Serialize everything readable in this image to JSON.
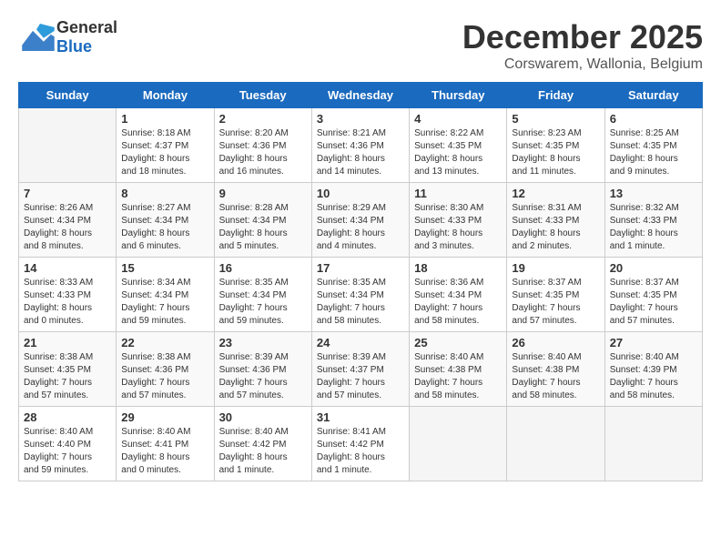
{
  "header": {
    "logo_general": "General",
    "logo_blue": "Blue",
    "month_title": "December 2025",
    "subtitle": "Corswarem, Wallonia, Belgium"
  },
  "weekdays": [
    "Sunday",
    "Monday",
    "Tuesday",
    "Wednesday",
    "Thursday",
    "Friday",
    "Saturday"
  ],
  "weeks": [
    [
      {
        "day": "",
        "info": ""
      },
      {
        "day": "1",
        "info": "Sunrise: 8:18 AM\nSunset: 4:37 PM\nDaylight: 8 hours\nand 18 minutes."
      },
      {
        "day": "2",
        "info": "Sunrise: 8:20 AM\nSunset: 4:36 PM\nDaylight: 8 hours\nand 16 minutes."
      },
      {
        "day": "3",
        "info": "Sunrise: 8:21 AM\nSunset: 4:36 PM\nDaylight: 8 hours\nand 14 minutes."
      },
      {
        "day": "4",
        "info": "Sunrise: 8:22 AM\nSunset: 4:35 PM\nDaylight: 8 hours\nand 13 minutes."
      },
      {
        "day": "5",
        "info": "Sunrise: 8:23 AM\nSunset: 4:35 PM\nDaylight: 8 hours\nand 11 minutes."
      },
      {
        "day": "6",
        "info": "Sunrise: 8:25 AM\nSunset: 4:35 PM\nDaylight: 8 hours\nand 9 minutes."
      }
    ],
    [
      {
        "day": "7",
        "info": "Sunrise: 8:26 AM\nSunset: 4:34 PM\nDaylight: 8 hours\nand 8 minutes."
      },
      {
        "day": "8",
        "info": "Sunrise: 8:27 AM\nSunset: 4:34 PM\nDaylight: 8 hours\nand 6 minutes."
      },
      {
        "day": "9",
        "info": "Sunrise: 8:28 AM\nSunset: 4:34 PM\nDaylight: 8 hours\nand 5 minutes."
      },
      {
        "day": "10",
        "info": "Sunrise: 8:29 AM\nSunset: 4:34 PM\nDaylight: 8 hours\nand 4 minutes."
      },
      {
        "day": "11",
        "info": "Sunrise: 8:30 AM\nSunset: 4:33 PM\nDaylight: 8 hours\nand 3 minutes."
      },
      {
        "day": "12",
        "info": "Sunrise: 8:31 AM\nSunset: 4:33 PM\nDaylight: 8 hours\nand 2 minutes."
      },
      {
        "day": "13",
        "info": "Sunrise: 8:32 AM\nSunset: 4:33 PM\nDaylight: 8 hours\nand 1 minute."
      }
    ],
    [
      {
        "day": "14",
        "info": "Sunrise: 8:33 AM\nSunset: 4:33 PM\nDaylight: 8 hours\nand 0 minutes."
      },
      {
        "day": "15",
        "info": "Sunrise: 8:34 AM\nSunset: 4:34 PM\nDaylight: 7 hours\nand 59 minutes."
      },
      {
        "day": "16",
        "info": "Sunrise: 8:35 AM\nSunset: 4:34 PM\nDaylight: 7 hours\nand 59 minutes."
      },
      {
        "day": "17",
        "info": "Sunrise: 8:35 AM\nSunset: 4:34 PM\nDaylight: 7 hours\nand 58 minutes."
      },
      {
        "day": "18",
        "info": "Sunrise: 8:36 AM\nSunset: 4:34 PM\nDaylight: 7 hours\nand 58 minutes."
      },
      {
        "day": "19",
        "info": "Sunrise: 8:37 AM\nSunset: 4:35 PM\nDaylight: 7 hours\nand 57 minutes."
      },
      {
        "day": "20",
        "info": "Sunrise: 8:37 AM\nSunset: 4:35 PM\nDaylight: 7 hours\nand 57 minutes."
      }
    ],
    [
      {
        "day": "21",
        "info": "Sunrise: 8:38 AM\nSunset: 4:35 PM\nDaylight: 7 hours\nand 57 minutes."
      },
      {
        "day": "22",
        "info": "Sunrise: 8:38 AM\nSunset: 4:36 PM\nDaylight: 7 hours\nand 57 minutes."
      },
      {
        "day": "23",
        "info": "Sunrise: 8:39 AM\nSunset: 4:36 PM\nDaylight: 7 hours\nand 57 minutes."
      },
      {
        "day": "24",
        "info": "Sunrise: 8:39 AM\nSunset: 4:37 PM\nDaylight: 7 hours\nand 57 minutes."
      },
      {
        "day": "25",
        "info": "Sunrise: 8:40 AM\nSunset: 4:38 PM\nDaylight: 7 hours\nand 58 minutes."
      },
      {
        "day": "26",
        "info": "Sunrise: 8:40 AM\nSunset: 4:38 PM\nDaylight: 7 hours\nand 58 minutes."
      },
      {
        "day": "27",
        "info": "Sunrise: 8:40 AM\nSunset: 4:39 PM\nDaylight: 7 hours\nand 58 minutes."
      }
    ],
    [
      {
        "day": "28",
        "info": "Sunrise: 8:40 AM\nSunset: 4:40 PM\nDaylight: 7 hours\nand 59 minutes."
      },
      {
        "day": "29",
        "info": "Sunrise: 8:40 AM\nSunset: 4:41 PM\nDaylight: 8 hours\nand 0 minutes."
      },
      {
        "day": "30",
        "info": "Sunrise: 8:40 AM\nSunset: 4:42 PM\nDaylight: 8 hours\nand 1 minute."
      },
      {
        "day": "31",
        "info": "Sunrise: 8:41 AM\nSunset: 4:42 PM\nDaylight: 8 hours\nand 1 minute."
      },
      {
        "day": "",
        "info": ""
      },
      {
        "day": "",
        "info": ""
      },
      {
        "day": "",
        "info": ""
      }
    ]
  ]
}
